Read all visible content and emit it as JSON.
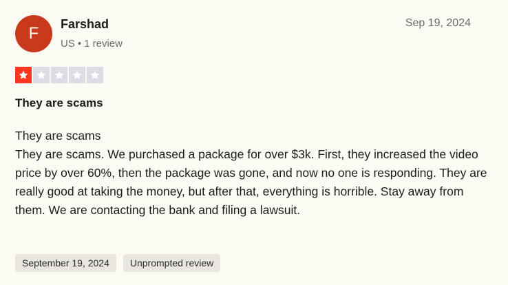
{
  "reviewer": {
    "initial": "F",
    "name": "Farshad",
    "country": "US",
    "separator": "•",
    "review_count": "1 review"
  },
  "review_date": "Sep 19, 2024",
  "rating": {
    "value": 1,
    "max": 5,
    "filled_color": "#ff3722",
    "empty_color": "#dcdce6"
  },
  "review": {
    "title": "They are scams",
    "body_lines": [
      "They are scams",
      "They are scams. We purchased a package for over $3k. First, they increased the video price by over 60%, then the package was gone, and now no one is responding. They are really good at taking the money, but after that, everything is horrible. Stay away from them. We are contacting the bank and filing a lawsuit."
    ]
  },
  "tags": {
    "date_of_experience": "September 19, 2024",
    "review_type": "Unprompted review"
  },
  "colors": {
    "avatar_bg": "#c8391b",
    "background": "#fcfbf3"
  }
}
